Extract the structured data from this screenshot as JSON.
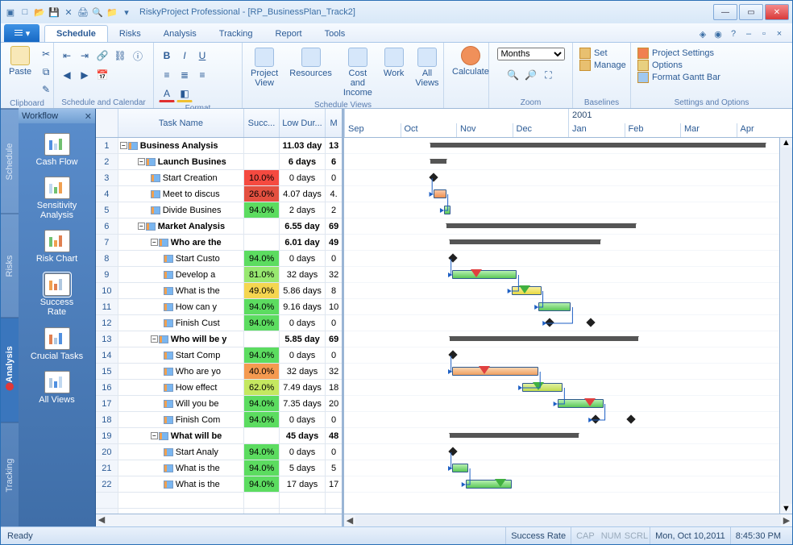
{
  "window": {
    "title": "RiskyProject Professional - [RP_BusinessPlan_Track2]"
  },
  "ribbon": {
    "tabs": [
      "Schedule",
      "Risks",
      "Analysis",
      "Tracking",
      "Report",
      "Tools"
    ],
    "active_tab": 0,
    "groups": {
      "clipboard": {
        "paste": "Paste",
        "label": "Clipboard"
      },
      "sched_cal": {
        "label": "Schedule and Calendar"
      },
      "format": {
        "label": "Format"
      },
      "sched_views": {
        "label": "Schedule Views",
        "project_view": "Project\nView",
        "resources": "Resources",
        "cost_income": "Cost and\nIncome",
        "work": "Work",
        "all_views": "All\nViews"
      },
      "calculate": {
        "label": "Calculate"
      },
      "zoom": {
        "select": "Months",
        "label": "Zoom"
      },
      "baselines": {
        "set": "Set",
        "manage": "Manage",
        "label": "Baselines"
      },
      "settings": {
        "project": "Project Settings",
        "options": "Options",
        "format_bar": "Format Gantt Bar",
        "label": "Settings and Options"
      }
    }
  },
  "side_tabs": [
    "Schedule",
    "Risks",
    "Analysis",
    "Tracking"
  ],
  "workflow": {
    "title": "Workflow",
    "items": [
      {
        "label": "Cash Flow"
      },
      {
        "label": "Sensitivity\nAnalysis"
      },
      {
        "label": "Risk Chart"
      },
      {
        "label": "Success\nRate"
      },
      {
        "label": "Crucial Tasks"
      },
      {
        "label": "All Views"
      }
    ],
    "selected": 3
  },
  "grid": {
    "headers": {
      "task": "Task Name",
      "succ": "Succ...",
      "lowdur": "Low Dur...",
      "m": "M"
    },
    "rows": [
      {
        "idx": 1,
        "level": 0,
        "summary": true,
        "name": "Business Analysis",
        "succ": "",
        "dur": "11.03 day",
        "m": "13"
      },
      {
        "idx": 2,
        "level": 1,
        "summary": true,
        "name": "Launch Busines",
        "succ": "",
        "dur": "6 days",
        "m": "6"
      },
      {
        "idx": 3,
        "level": 2,
        "summary": false,
        "name": "Start Creation",
        "succ": "10.0%",
        "pbg": "pbg-red",
        "dur": "0 days",
        "m": "0"
      },
      {
        "idx": 4,
        "level": 2,
        "summary": false,
        "name": "Meet to discus",
        "succ": "26.0%",
        "pbg": "pbg-dkred",
        "dur": "4.07 days",
        "m": "4."
      },
      {
        "idx": 5,
        "level": 2,
        "summary": false,
        "name": "Divide Busines",
        "succ": "94.0%",
        "pbg": "pbg-green",
        "dur": "2 days",
        "m": "2"
      },
      {
        "idx": 6,
        "level": 1,
        "summary": true,
        "name": "Market Analysis",
        "succ": "",
        "dur": "6.55 day",
        "m": "69"
      },
      {
        "idx": 7,
        "level": 2,
        "summary": true,
        "name": "Who are the",
        "succ": "",
        "dur": "6.01 day",
        "m": "49"
      },
      {
        "idx": 8,
        "level": 3,
        "summary": false,
        "name": "Start Custo",
        "succ": "94.0%",
        "pbg": "pbg-green",
        "dur": "0 days",
        "m": "0"
      },
      {
        "idx": 9,
        "level": 3,
        "summary": false,
        "name": "Develop a",
        "succ": "81.0%",
        "pbg": "pbg-lgrn",
        "dur": "32 days",
        "m": "32"
      },
      {
        "idx": 10,
        "level": 3,
        "summary": false,
        "name": "What is the",
        "succ": "49.0%",
        "pbg": "pbg-yel",
        "dur": "5.86 days",
        "m": "8"
      },
      {
        "idx": 11,
        "level": 3,
        "summary": false,
        "name": "How can y",
        "succ": "94.0%",
        "pbg": "pbg-green",
        "dur": "9.16 days",
        "m": "10"
      },
      {
        "idx": 12,
        "level": 3,
        "summary": false,
        "name": "Finish Cust",
        "succ": "94.0%",
        "pbg": "pbg-green",
        "dur": "0 days",
        "m": "0"
      },
      {
        "idx": 13,
        "level": 2,
        "summary": true,
        "name": "Who will be y",
        "succ": "",
        "dur": "5.85 day",
        "m": "69"
      },
      {
        "idx": 14,
        "level": 3,
        "summary": false,
        "name": "Start Comp",
        "succ": "94.0%",
        "pbg": "pbg-green",
        "dur": "0 days",
        "m": "0"
      },
      {
        "idx": 15,
        "level": 3,
        "summary": false,
        "name": "Who are yo",
        "succ": "40.0%",
        "pbg": "pbg-org",
        "dur": "32 days",
        "m": "32"
      },
      {
        "idx": 16,
        "level": 3,
        "summary": false,
        "name": "How effect",
        "succ": "62.0%",
        "pbg": "pbg-ylg",
        "dur": "7.49 days",
        "m": "18"
      },
      {
        "idx": 17,
        "level": 3,
        "summary": false,
        "name": "Will you be",
        "succ": "94.0%",
        "pbg": "pbg-green",
        "dur": "7.35 days",
        "m": "20"
      },
      {
        "idx": 18,
        "level": 3,
        "summary": false,
        "name": "Finish Com",
        "succ": "94.0%",
        "pbg": "pbg-green",
        "dur": "0 days",
        "m": "0"
      },
      {
        "idx": 19,
        "level": 2,
        "summary": true,
        "name": "What will be",
        "succ": "",
        "dur": "45 days",
        "m": "48"
      },
      {
        "idx": 20,
        "level": 3,
        "summary": false,
        "name": "Start Analy",
        "succ": "94.0%",
        "pbg": "pbg-green",
        "dur": "0 days",
        "m": "0"
      },
      {
        "idx": 21,
        "level": 3,
        "summary": false,
        "name": "What is the",
        "succ": "94.0%",
        "pbg": "pbg-green",
        "dur": "5 days",
        "m": "5"
      },
      {
        "idx": 22,
        "level": 3,
        "summary": false,
        "name": "What is the",
        "succ": "94.0%",
        "pbg": "pbg-green",
        "dur": "17 days",
        "m": "17"
      }
    ]
  },
  "gantt": {
    "year_cols": [
      "",
      "2001"
    ],
    "months": [
      "Sep",
      "Oct",
      "Nov",
      "Dec",
      "Jan",
      "Feb",
      "Mar",
      "Apr"
    ]
  },
  "status": {
    "ready": "Ready",
    "view": "Success Rate",
    "cap": "CAP",
    "num": "NUM",
    "scrl": "SCRL",
    "date": "Mon, Oct 10,2011",
    "time": "8:45:30 PM"
  }
}
